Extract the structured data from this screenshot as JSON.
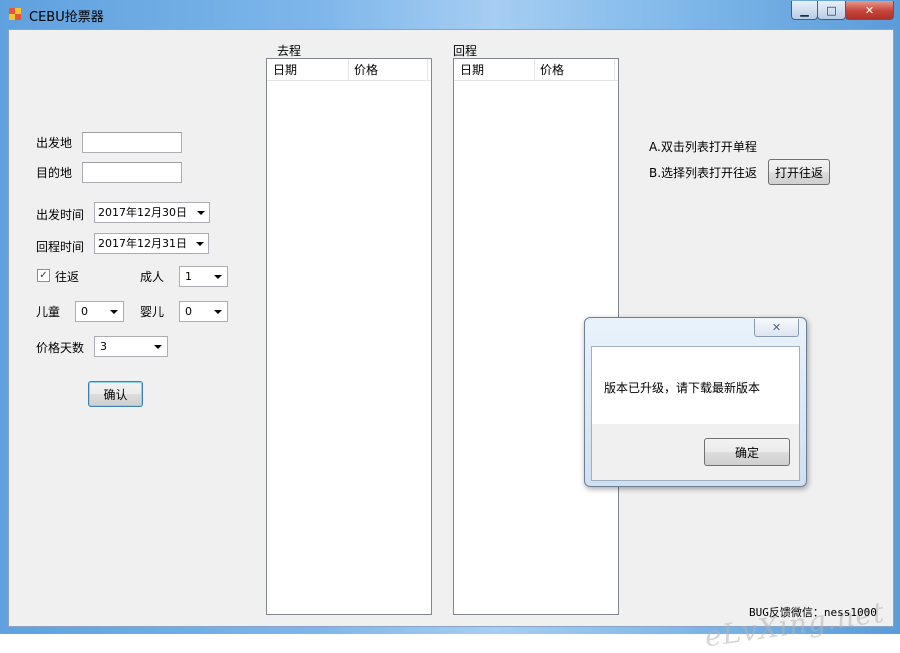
{
  "window": {
    "title": "CEBU抢票器",
    "controls": {
      "minimize": "▁",
      "maximize": "□",
      "close": "✕"
    }
  },
  "form": {
    "from_label": "出发地",
    "from_value": "",
    "to_label": "目的地",
    "to_value": "",
    "depart_time_label": "出发时间",
    "depart_date": "2017年12月30日",
    "return_time_label": "回程时间",
    "return_date": "2017年12月31日",
    "roundtrip_label": "往返",
    "roundtrip_checked": true,
    "adult_label": "成人",
    "adult_value": "1",
    "child_label": "儿童",
    "child_value": "0",
    "infant_label": "婴儿",
    "infant_value": "0",
    "price_days_label": "价格天数",
    "price_days_value": "3",
    "confirm_label": "确认"
  },
  "outbound": {
    "title": "去程",
    "columns": [
      "日期",
      "价格"
    ]
  },
  "inbound": {
    "title": "回程",
    "columns": [
      "日期",
      "价格"
    ]
  },
  "instructions": {
    "a": "A.双击列表打开单程",
    "b": "B.选择列表打开往返",
    "open_roundtrip_button": "打开往返"
  },
  "dialog": {
    "close": "✕",
    "message": "版本已升级，请下载最新版本",
    "ok_label": "确定"
  },
  "footer": {
    "text": "BUG反馈微信：ness1000"
  },
  "colors": {
    "window_frame": "#7db6ea",
    "client_bg": "#f0f0f0",
    "close_button": "#c6443a"
  }
}
